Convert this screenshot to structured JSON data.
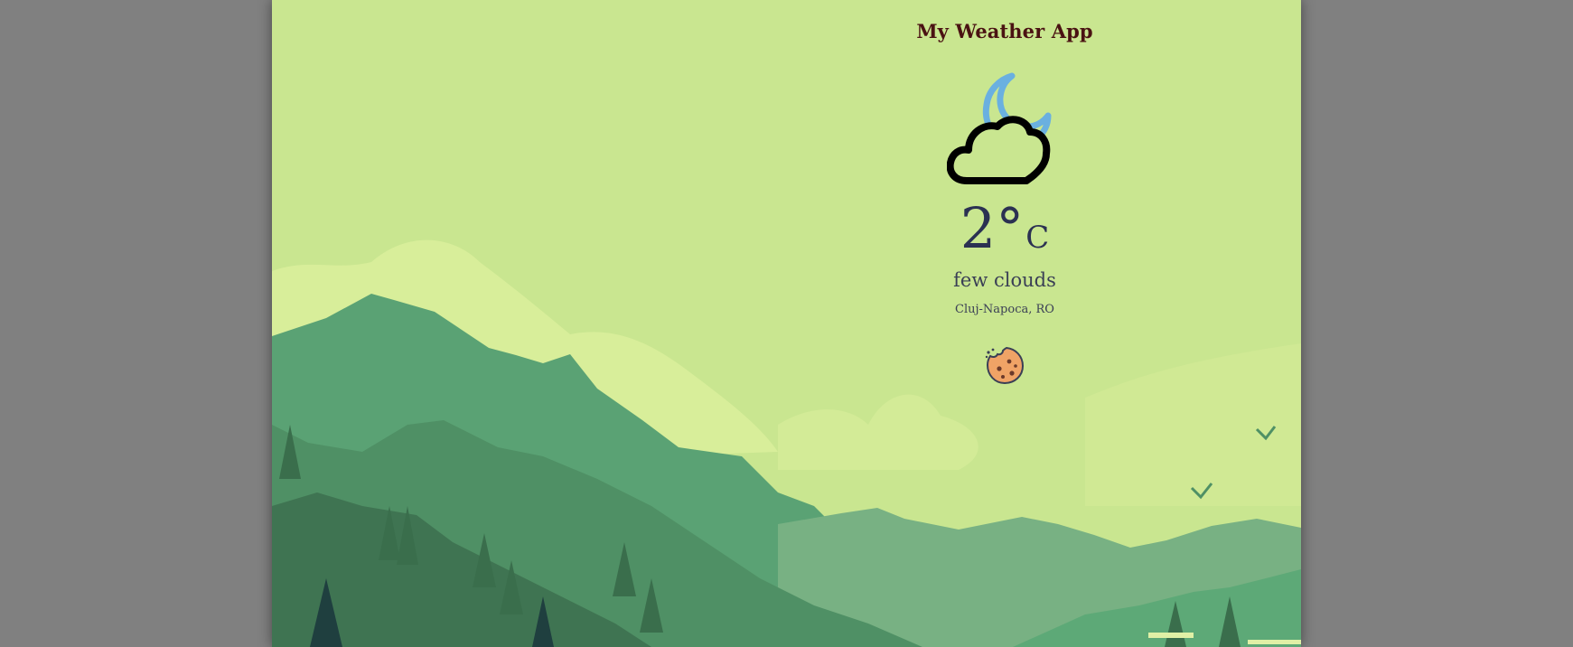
{
  "app": {
    "title": "My Weather App"
  },
  "weather": {
    "icon": "cloud-moon-icon",
    "temperature": "2°",
    "unit": "C",
    "condition": "few clouds",
    "location": "Cluj-Napoca, RO"
  },
  "footer": {
    "cookie_icon": "cookie-icon"
  },
  "colors": {
    "page_bg": "#808080",
    "sky": "#c9e690",
    "title": "#4a1212",
    "temperature_text": "#2b3152",
    "moon": "#6ab0e0",
    "cloud_stroke": "#000000",
    "cookie": "#f0a366"
  }
}
